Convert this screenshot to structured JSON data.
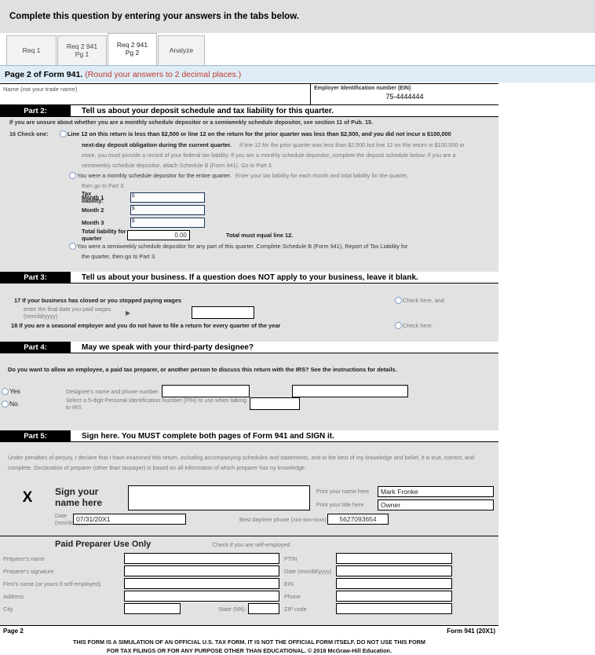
{
  "banner": {
    "text": "Complete this question by entering your answers in the tabs below."
  },
  "tabs": [
    {
      "label": "Req 1",
      "active": false
    },
    {
      "label": "Req 2 941 Pg 1",
      "active": false
    },
    {
      "label": "Req 2 941 Pg 2",
      "active": true
    },
    {
      "label": "Analyze",
      "active": false
    }
  ],
  "subheader": {
    "title": "Page 2 of Form 941.",
    "hint": "(Round your answers to 2 decimal places.)"
  },
  "form": {
    "name_label": "Name (not your trade name)",
    "name_value": "",
    "ein_label": "Employer Identification number (EIN)",
    "ein_value": "75-4444444",
    "part2": {
      "num": "Part 2:",
      "title": "Tell us about your deposit schedule and tax liability for this quarter.",
      "note": "If you are unsure about whether you are a monthly schedule depositor or a semiweekly schedule depositor, see section 11 of Pub. 15.",
      "line16_num": "16  Check one:",
      "opt1_bold": "Line 12 on this return is less than $2,500 or line 12 on the return for the prior quarter was less than $2,500, and you did not incur a $100,000",
      "opt1_bold2": "next-day deposit obligation during the current quarter.",
      "opt1_light1": "If line 12 for the prior quarter was less than $2,500 but line 12 on this return is $100,000 or",
      "opt1_light2": "more, you must provide a record of your federal tax liability.  If you are a monthly schedule depositor, complete the deposit schedule below; if you are a",
      "opt1_light3": "semiweekly schedule depositor, attach Schedule B (Form 941).  Go to Part 3.",
      "opt2": "You were a monthly schedule depositor for the entire quarter.",
      "opt2_right": "Enter your tax liability for each month and total liability for the quarter,",
      "opt2_cont": "then go to Part 3.",
      "taxliab_label": "Tax liability:",
      "months": [
        {
          "label": "Month 1",
          "value": ""
        },
        {
          "label": "Month 2",
          "value": ""
        },
        {
          "label": "Month 3",
          "value": ""
        }
      ],
      "total_label": "Total liability for quarter",
      "total_value": "0.00",
      "total_note": "Total must equal line 12.",
      "opt3": "You were a semiweekly schedule depositor for any part of this quarter.  Complete Schedule B (Form 941), Report of Tax Liability for",
      "opt3_cont": "the quarter, then go to Part 3."
    },
    "part3": {
      "num": "Part 3:",
      "title": "Tell us about your business. If a question does NOT apply to your business, leave it blank.",
      "line17": "17 If your business has closed or you stopped paying wages",
      "line17_check": "Check here, and",
      "line17_sub": "enter the final date you paid wages (mm/dd/yyyy)",
      "line17_date": "",
      "line18": "18 If you are a seasonal employer and you do not have to file a return for every quarter of the year",
      "line18_check": "Check here."
    },
    "part4": {
      "num": "Part 4:",
      "title": "May we speak with your third-party designee?",
      "question": "Do you want to allow an employee, a paid tax preparer, or another person to discuss this return with the IRS?  See the instructions for details.",
      "yes": "Yes",
      "no": "No",
      "designee_label": "Designee's name and phone number",
      "designee_name": "",
      "designee_phone": "",
      "pin_label": "Select a 5-digit Personal Identification Number (PIN) to use when talking to IRS",
      "pin_value": ""
    },
    "part5": {
      "num": "Part 5:",
      "title": "Sign here. You MUST complete both pages of Form 941 and SIGN it.",
      "perjury1": "Under penalties of perjury, I declare that I have examined this return, including accompanying schedules and statements, and to the best of my knowledge and belief, it is true, correct, and",
      "perjury2": "complete. Declaration of preparer (other than taxpayer) is based on all information of which preparer has ny knowledge.",
      "x_mark": "X",
      "sign_label_1": "Sign your",
      "sign_label_2": "name here",
      "signature_value": "",
      "print_name_label": "Print your name here",
      "print_name_value": "Mark Fronke",
      "print_title_label": "Print your title here",
      "print_title_value": "Owner",
      "date_label": "Date (mm/dd/yyyy)",
      "date_value": "07/31/20X1",
      "phone_label": "Best daytime phone (xxx-xxx-xxxx)",
      "phone_value": "5627093654"
    },
    "preparer": {
      "heading": "Paid Preparer Use Only",
      "self_employed": "Check if you are self-employed",
      "rows": [
        {
          "left_label": "Preparer's name",
          "left_value": "",
          "right_label": "PTIN",
          "right_value": ""
        },
        {
          "left_label": "Preparer's signature",
          "left_value": "",
          "right_label": "Date (mm/dd/yyyy)",
          "right_value": ""
        },
        {
          "left_label": "Firm's name (or yours if self-employed)",
          "left_value": "",
          "right_label": "EIN",
          "right_value": ""
        },
        {
          "left_label": "Address",
          "left_value": "",
          "right_label": "Phone",
          "right_value": ""
        }
      ],
      "city_label": "City",
      "city_value": "",
      "state_label": "State (NN)",
      "state_value": "",
      "zip_label": "ZIP code",
      "zip_value": ""
    },
    "footer": {
      "page": "Page 2",
      "formid": "Form 941 (20X1)",
      "disclaimer1": "THIS FORM IS A SIMULATION OF AN OFFICIAL U.S. TAX FORM. IT IS NOT THE OFFICIAL FORM ITSELF. DO NOT USE THIS FORM",
      "disclaimer2": "FOR TAX FILINGS OR FOR ANY PURPOSE OTHER THAN EDUCATIONAL. © 2018 McGraw-Hill Education."
    }
  }
}
